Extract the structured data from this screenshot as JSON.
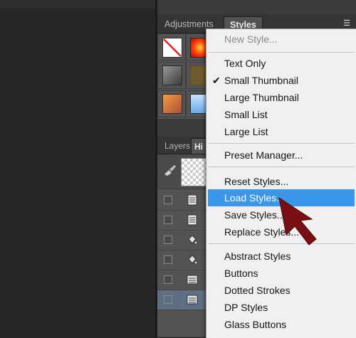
{
  "panels": {
    "adjustments_tab": "Adjustments",
    "styles_tab": "Styles",
    "layers_tab": "Layers",
    "history_tab": "Hi"
  },
  "menu": {
    "items": [
      {
        "label": "New Style...",
        "state": "disabled"
      },
      {
        "label": "Text Only",
        "state": "normal"
      },
      {
        "label": "Small Thumbnail",
        "state": "checked"
      },
      {
        "label": "Large Thumbnail",
        "state": "normal"
      },
      {
        "label": "Small List",
        "state": "normal"
      },
      {
        "label": "Large List",
        "state": "normal"
      },
      {
        "label": "Preset Manager...",
        "state": "normal"
      },
      {
        "label": "Reset Styles...",
        "state": "normal"
      },
      {
        "label": "Load Styles...",
        "state": "highlighted"
      },
      {
        "label": "Save Styles...",
        "state": "normal"
      },
      {
        "label": "Replace Styles...",
        "state": "normal"
      },
      {
        "label": "Abstract Styles",
        "state": "normal"
      },
      {
        "label": "Buttons",
        "state": "normal"
      },
      {
        "label": "Dotted Strokes",
        "state": "normal"
      },
      {
        "label": "DP Styles",
        "state": "normal"
      },
      {
        "label": "Glass Buttons",
        "state": "normal"
      }
    ],
    "checkmark": "✔"
  },
  "colors": {
    "highlight": "#3a96e8",
    "arrow": "#7a0f12"
  }
}
